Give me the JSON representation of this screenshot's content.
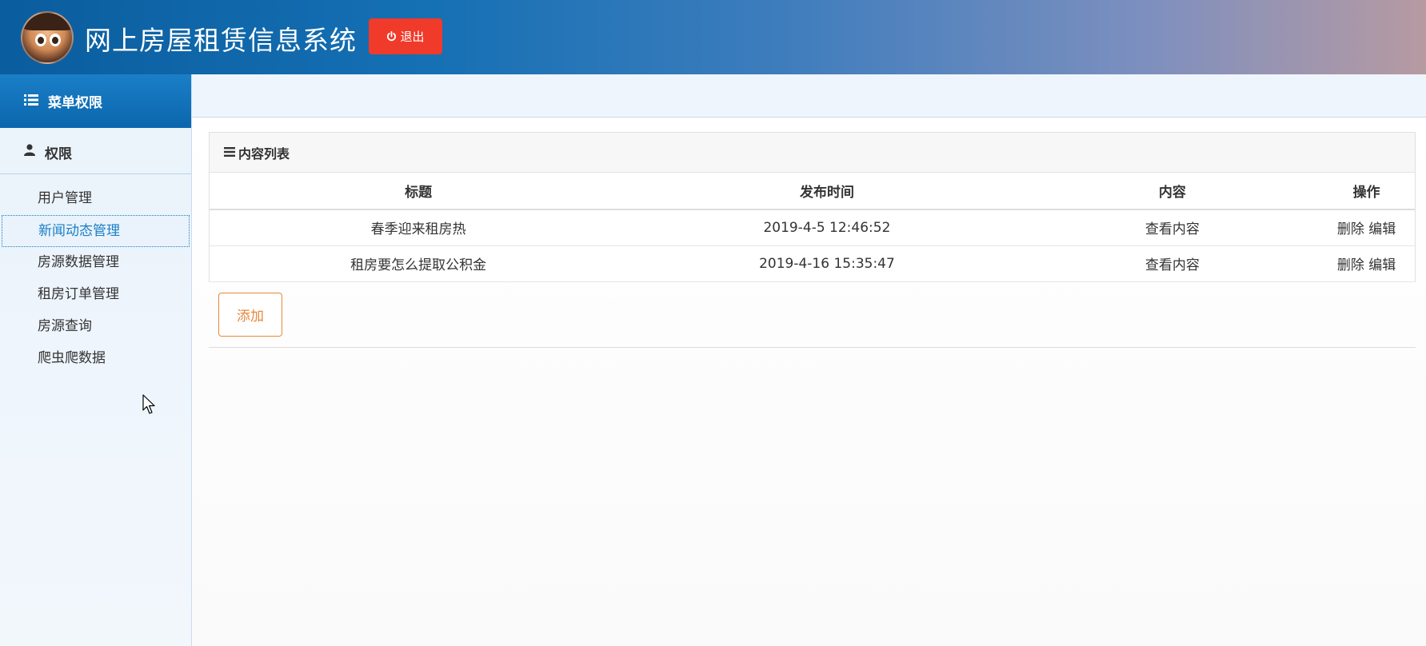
{
  "header": {
    "title": "网上房屋租赁信息系统",
    "logout_label": "退出"
  },
  "sidebar": {
    "menu_title": "菜单权限",
    "section_title": "权限",
    "items": [
      {
        "label": "用户管理",
        "active": false
      },
      {
        "label": "新闻动态管理",
        "active": true
      },
      {
        "label": "房源数据管理",
        "active": false
      },
      {
        "label": "租房订单管理",
        "active": false
      },
      {
        "label": "房源查询",
        "active": false
      },
      {
        "label": "爬虫爬数据",
        "active": false
      }
    ]
  },
  "content": {
    "panel_title": "内容列表",
    "columns": [
      "标题",
      "发布时间",
      "内容",
      "操作"
    ],
    "rows": [
      {
        "title": "春季迎来租房热",
        "time": "2019-4-5 12:46:52",
        "content": "查看内容",
        "delete": "删除",
        "edit": "编辑"
      },
      {
        "title": "租房要怎么提取公积金",
        "time": "2019-4-16 15:35:47",
        "content": "查看内容",
        "delete": "删除",
        "edit": "编辑"
      }
    ],
    "add_label": "添加"
  },
  "colors": {
    "header_start": "#0a5d9e",
    "logout": "#f03a2a",
    "accent": "#1a7fc7",
    "add_button": "#e8883a"
  }
}
